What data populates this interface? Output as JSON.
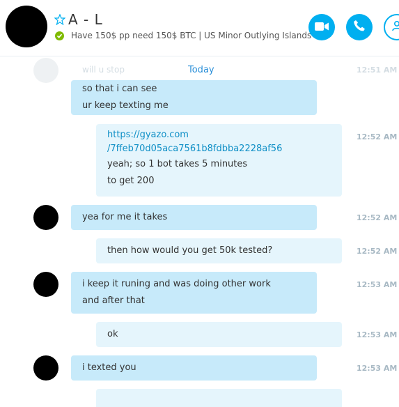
{
  "header": {
    "contact_name": "A - L",
    "mood": "Have 150$ pp need 150$ BTC  |  US Minor Outlying Islands",
    "accent_color": "#00aff0",
    "status_color": "#7fba00",
    "buttons": [
      {
        "name": "video-call-button",
        "icon": "video-camera-icon"
      },
      {
        "name": "audio-call-button",
        "icon": "phone-icon"
      },
      {
        "name": "add-contact-button",
        "icon": "add-person-icon"
      }
    ]
  },
  "chat": {
    "day_label": "Today",
    "ghost": {
      "text": "will u stop",
      "time": "12:51 AM"
    },
    "messages": [
      {
        "direction": "incoming",
        "lines": [
          "so that i can see",
          "ur keep texting me"
        ],
        "time": ""
      },
      {
        "direction": "outgoing",
        "link_lines": [
          "https://gyazo.com",
          "/7ffeb70d05aca7561b8fdbba2228af56"
        ],
        "lines": [
          "yeah; so 1 bot takes 5 minutes",
          "to get 200"
        ],
        "time": "12:52 AM"
      },
      {
        "direction": "incoming",
        "lines": [
          "yea for me it takes"
        ],
        "time": "12:52 AM"
      },
      {
        "direction": "outgoing",
        "lines": [
          "then how would you get 50k tested?"
        ],
        "time": "12:52 AM"
      },
      {
        "direction": "incoming",
        "lines": [
          "i keep it runing and was doing other work",
          "and after that"
        ],
        "time": "12:53 AM"
      },
      {
        "direction": "outgoing",
        "lines": [
          "ok"
        ],
        "time": "12:53 AM"
      },
      {
        "direction": "incoming",
        "lines": [
          "i texted you"
        ],
        "time": "12:53 AM"
      }
    ]
  }
}
